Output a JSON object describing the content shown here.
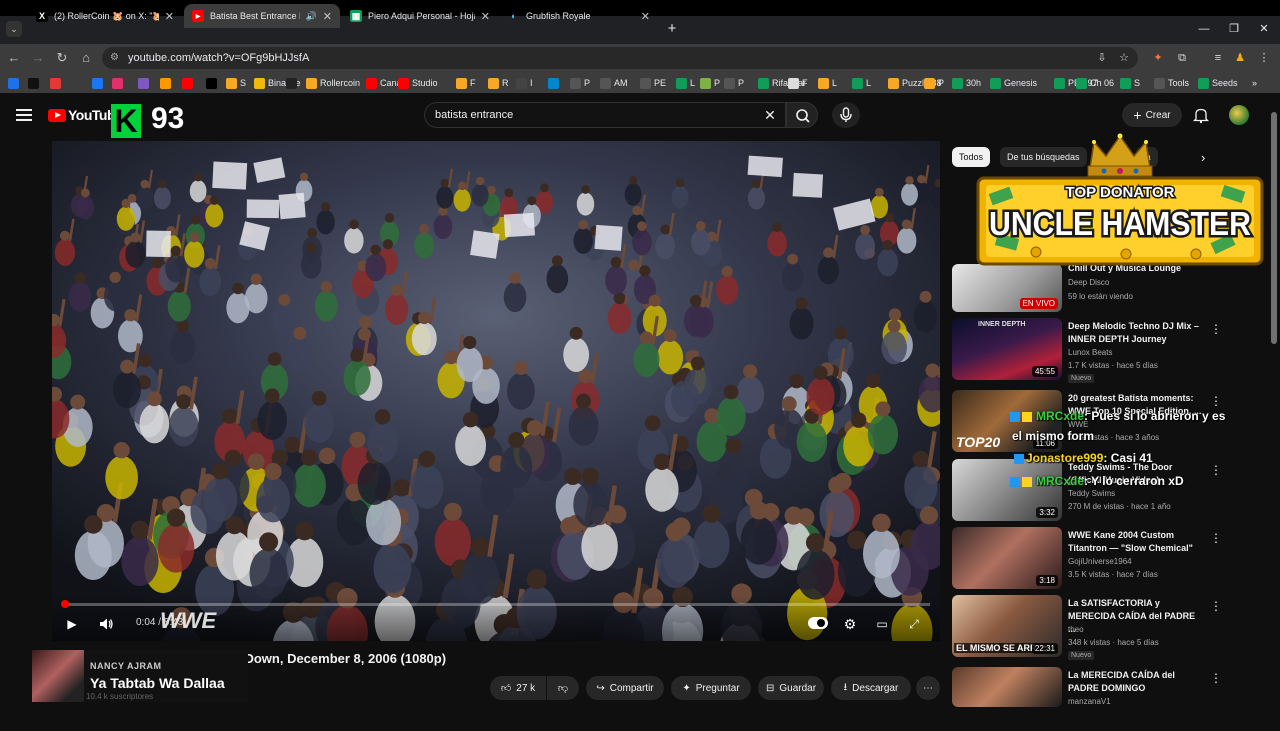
{
  "browser": {
    "tabs": [
      {
        "title": "(2) RollerCoin 🐹 on X: \"🐹 DE",
        "favicon": "x-icon",
        "active": false
      },
      {
        "title": "Batista Best Entrance Ever! S",
        "favicon": "youtube-icon",
        "active": true
      },
      {
        "title": "Piero Adqui Personal - Hojas de",
        "favicon": "sheets-icon",
        "active": false
      },
      {
        "title": "Grubfish Royale",
        "favicon": "grubfish-icon",
        "active": false
      }
    ],
    "url": "youtube.com/watch?v=OFg9bHJJsfA",
    "bookmarks": [
      {
        "label": "",
        "color": "#1a73e8"
      },
      {
        "label": "",
        "color": "#111111"
      },
      {
        "label": "",
        "color": "#e53935"
      },
      {
        "label": "",
        "color": "#1877f2"
      },
      {
        "label": "",
        "color": "#e1306c"
      },
      {
        "label": "",
        "color": "#7e57c2"
      },
      {
        "label": "",
        "color": "#ff9800"
      },
      {
        "label": "",
        "color": "#ff0000"
      },
      {
        "label": "",
        "color": "#000000"
      },
      {
        "label": "S",
        "color": "#f9a825"
      },
      {
        "label": "Binance",
        "color": "#f0b90b"
      },
      {
        "label": "",
        "color": "#222222"
      },
      {
        "label": "Rollercoin",
        "color": "#f9a825"
      },
      {
        "label": "Canal",
        "color": "#ff0000"
      },
      {
        "label": "Studio",
        "color": "#ff0000"
      },
      {
        "label": "F",
        "color": "#f9a825"
      },
      {
        "label": "R",
        "color": "#f9a825"
      },
      {
        "label": "I",
        "color": "#444444"
      },
      {
        "label": "",
        "color": "#0088cc"
      },
      {
        "label": "P",
        "color": "#555555"
      },
      {
        "label": "AM",
        "color": "#555555"
      },
      {
        "label": "PE",
        "color": "#555555"
      },
      {
        "label": "L",
        "color": "#0f9d58"
      },
      {
        "label": "P",
        "color": "#7cb342"
      },
      {
        "label": "P",
        "color": "#555555"
      },
      {
        "label": "Rifa Mar",
        "color": "#0f9d58"
      },
      {
        "label": "F",
        "color": "#dddddd"
      },
      {
        "label": "L",
        "color": "#f9a825"
      },
      {
        "label": "L",
        "color": "#0f9d58"
      },
      {
        "label": "Puzzle 88",
        "color": "#f9a825"
      },
      {
        "label": "P",
        "color": "#f9a825"
      },
      {
        "label": "30h",
        "color": "#0f9d58"
      },
      {
        "label": "Genesis",
        "color": "#0f9d58"
      },
      {
        "label": "PE 197",
        "color": "#0f9d58"
      },
      {
        "label": "Ch 06",
        "color": "#0f9d58"
      },
      {
        "label": "S",
        "color": "#0f9d58"
      },
      {
        "label": "Tools",
        "color": "#555555"
      },
      {
        "label": "Seeds",
        "color": "#0f9d58"
      }
    ],
    "bookmarks_more": "»"
  },
  "youtube": {
    "logo_text": "YouTube",
    "overlay_logo_letter": "K",
    "overlay_number": "93",
    "search_value": "batista entrance",
    "create_label": "Crear",
    "chips": [
      "Todos",
      "De tus búsquedas",
      "ta"
    ],
    "player": {
      "time": "0:04 / 8:43",
      "progress": 0.0076,
      "watermark": "WWE"
    },
    "video_title": "ckDown, December 8, 2006 (1080p)",
    "channel_overlay": {
      "artist": "NANCY AJRAM",
      "song": "Ya Tabtab Wa Dallaa",
      "subscribers": "10.4 k suscriptores"
    },
    "actions": {
      "likes": "27 k",
      "share": "Compartir",
      "ask": "Preguntar",
      "save": "Guardar",
      "download": "Descargar"
    },
    "donator": {
      "label": "TOP DONATOR",
      "name": "UNCLE HAMSTER"
    },
    "sidebar": [
      {
        "title": "Chill Out y Música Lounge",
        "channel": "Deep Disco",
        "meta": "59 lo están viendo",
        "badge": "EN VIVO",
        "live": true,
        "new": ""
      },
      {
        "title": "Deep Melodic Techno DJ Mix – INNER DEPTH Journey",
        "channel": "Lunox Beats",
        "meta": "1.7 K vistas · hace 5 días",
        "badge": "45:55",
        "live": false,
        "new": "Nuevo",
        "thumb_text": "INNER DEPTH"
      },
      {
        "title": "20 greatest Batista moments: WWE Top 10 Special Edition, ...",
        "channel": "WWE",
        "meta": "M de vistas · hace 3 años",
        "badge": "11:06",
        "live": false,
        "new": "",
        "thumb_text": "TOP20"
      },
      {
        "title": "Teddy Swims - The Door (Official Music Video)",
        "channel": "Teddy Swims",
        "meta": "270 M de vistas · hace 1 año",
        "badge": "3:32",
        "live": false,
        "new": ""
      },
      {
        "title": "WWE Kane 2004 Custom Titantron — \"Slow Chemical\"",
        "channel": "GojiUniverse1964",
        "meta": "3.5 K vistas · hace 7 días",
        "badge": "3:18",
        "live": false,
        "new": ""
      },
      {
        "title": "La SATISFACTORIA y MERECIDA CAÍDA del PADRE ...",
        "channel": "theo",
        "meta": "348 k vistas · hace 5 días",
        "badge": "22:31",
        "live": false,
        "new": "Nuevo",
        "thumb_text": "EL MISMO SE ARR"
      },
      {
        "title": "La MERECIDA CAÍDA del PADRE DOMINGO",
        "channel": "manzanaV1",
        "meta": "",
        "badge": "",
        "live": false,
        "new": ""
      }
    ],
    "chat_overlay": [
      {
        "user": "MRCxde",
        "message": ": Pues si lo abrieron y es",
        "color": "#35d43a"
      },
      {
        "user": "",
        "message": "el mismo form",
        "color": "#ffffff"
      },
      {
        "user": "Jonastore999",
        "message": ": Casi 41",
        "color": "#f9d423"
      },
      {
        "user": "MRCxde",
        "message": ": Y lo cerraron xD",
        "color": "#35d43a"
      }
    ]
  }
}
